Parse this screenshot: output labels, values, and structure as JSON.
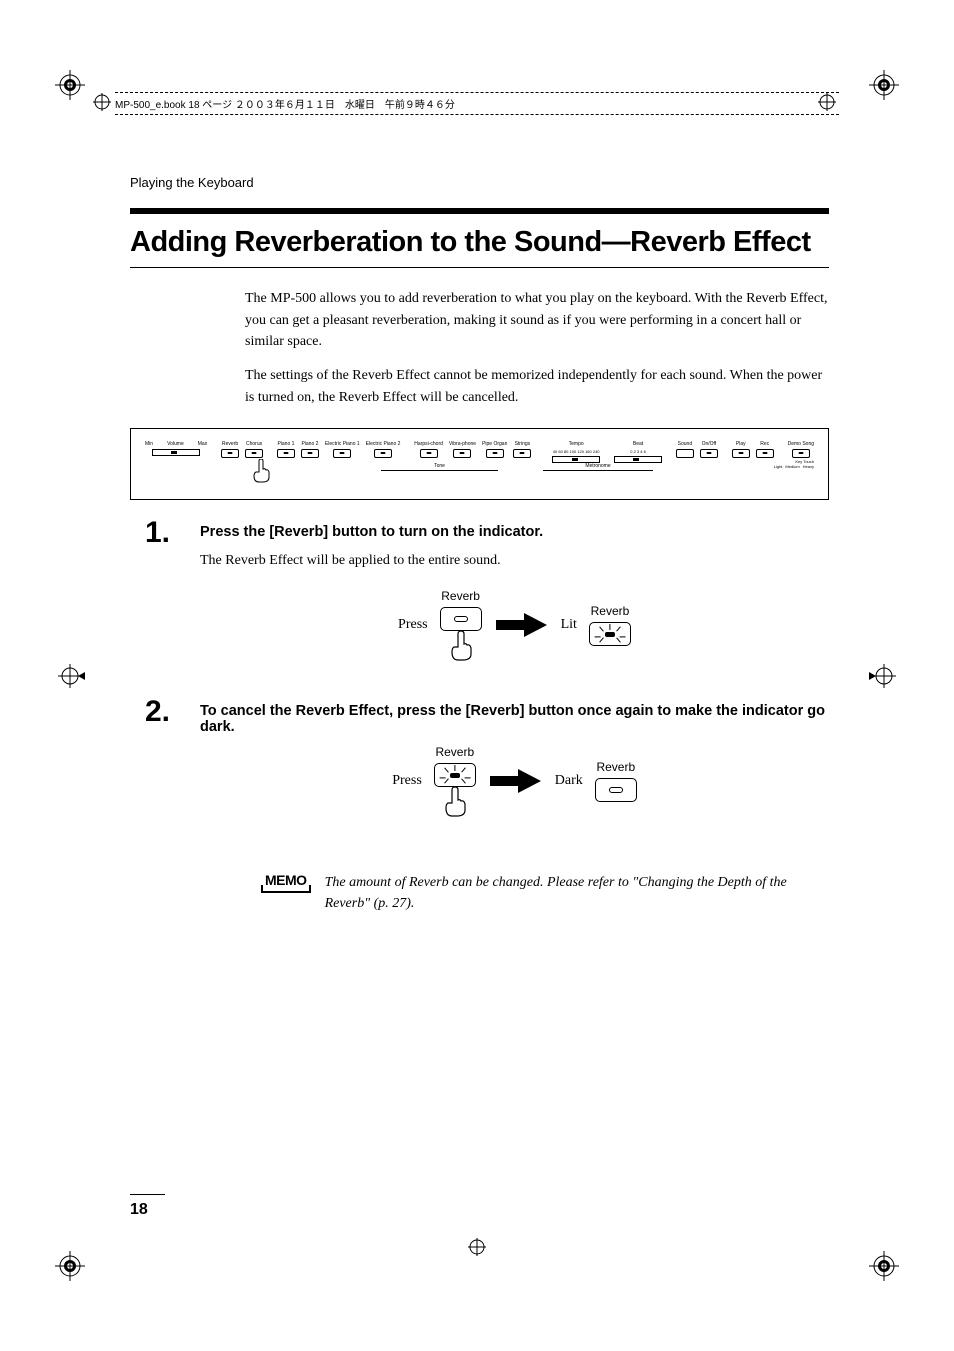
{
  "header": {
    "running_text": "MP-500_e.book 18 ページ ２００３年６月１１日　水曜日　午前９時４６分"
  },
  "breadcrumb": "Playing the Keyboard",
  "title": "Adding Reverberation to the Sound—Reverb Effect",
  "intro": {
    "p1": "The MP-500 allows you to add reverberation to what you play on the keyboard. With the Reverb Effect, you can get a pleasant reverberation, making it sound as if you were performing in a concert hall or similar space.",
    "p2": "The settings of the Reverb Effect cannot be memorized independently for each sound. When the power is turned on, the Reverb Effect will be cancelled."
  },
  "panel": {
    "volume_min": "Min",
    "volume_label": "Volume",
    "volume_max": "Max",
    "reverb": "Reverb",
    "chorus": "Chorus",
    "piano1": "Piano 1",
    "piano2": "Piano 2",
    "epiano1": "Electric Piano 1",
    "epiano2": "Electric Piano 2",
    "harpsichord": "Harpsi-chord",
    "vibraphone": "Vibra-phone",
    "pipeorgan": "Pipe Organ",
    "strings": "Strings",
    "tone_label": "Tone",
    "tempo": "Tempo",
    "tempo_marks": "40 60 80 100 120 160 240",
    "beat": "Beat",
    "beat_marks": "0   2   3   4   6",
    "metronome": "Metronome",
    "sound": "Sound",
    "onoff": "On/Off",
    "play": "Play",
    "rec": "Rec",
    "demo": "Demo Song",
    "keytouch": "Key Touch",
    "light": "Light",
    "medium": "Medium",
    "heavy": "Heavy"
  },
  "steps": [
    {
      "num": "1.",
      "heading": "Press the [Reverb] button to turn on the indicator.",
      "text": "The Reverb Effect will be applied to the entire sound.",
      "figure": {
        "left_label": "Press",
        "left_top": "Reverb",
        "right_label": "Lit",
        "right_top": "Reverb"
      }
    },
    {
      "num": "2.",
      "heading": "To cancel the Reverb Effect, press the [Reverb] button once again to make the indicator go dark.",
      "text": "",
      "figure": {
        "left_label": "Press",
        "left_top": "Reverb",
        "right_label": "Dark",
        "right_top": "Reverb"
      }
    }
  ],
  "memo": {
    "label": "MEMO",
    "text": "The amount of Reverb can be changed. Please refer to \"Changing the Depth of the Reverb\" (p. 27)."
  },
  "page_number": "18"
}
